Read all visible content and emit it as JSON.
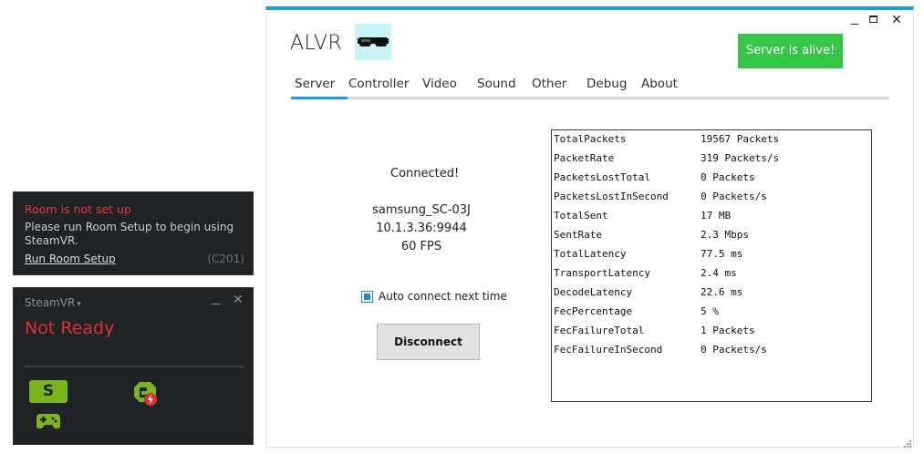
{
  "steamvr_notification": {
    "title": "Room is not set up",
    "message": "Please run Room Setup to begin using SteamVR.",
    "link": "Run Room Setup",
    "code": "(C201)"
  },
  "steamvr_window": {
    "title": "SteamVR",
    "caret": "▾",
    "close": "✕",
    "status": "Not Ready",
    "headset_icon_letter": "S",
    "status_color": "#e0302c",
    "accent_color": "#7ab51d"
  },
  "alvr": {
    "title": "ALVR",
    "server_status": "Server is alive!",
    "close": "✕",
    "tabs": [
      "Server",
      "Controller",
      "Video",
      "Sound",
      "Other",
      "Debug",
      "About"
    ],
    "active_tab": "Server",
    "connection_status": "Connected!",
    "device": {
      "name": "samsung_SC-03J",
      "address": "10.1.3.36:9944",
      "fps": "60 FPS"
    },
    "auto_connect": {
      "label": "Auto connect next time",
      "checked": true
    },
    "disconnect_label": "Disconnect",
    "stats": [
      {
        "name": "TotalPackets",
        "value": "19567 Packets"
      },
      {
        "name": "PacketRate",
        "value": "319 Packets/s"
      },
      {
        "name": "PacketsLostTotal",
        "value": "0 Packets"
      },
      {
        "name": "PacketsLostInSecond",
        "value": "0 Packets/s"
      },
      {
        "name": "TotalSent",
        "value": "17 MB"
      },
      {
        "name": "SentRate",
        "value": "2.3 Mbps"
      },
      {
        "name": "TotalLatency",
        "value": "77.5 ms"
      },
      {
        "name": "TransportLatency",
        "value": "2.4 ms"
      },
      {
        "name": "DecodeLatency",
        "value": "22.6 ms"
      },
      {
        "name": "FecPercentage",
        "value": "5 %"
      },
      {
        "name": "FecFailureTotal",
        "value": "1 Packets"
      },
      {
        "name": "FecFailureInSecond",
        "value": "0 Packets/s"
      }
    ],
    "accent_color": "#1aa0db",
    "badge_color": "#37c548"
  }
}
